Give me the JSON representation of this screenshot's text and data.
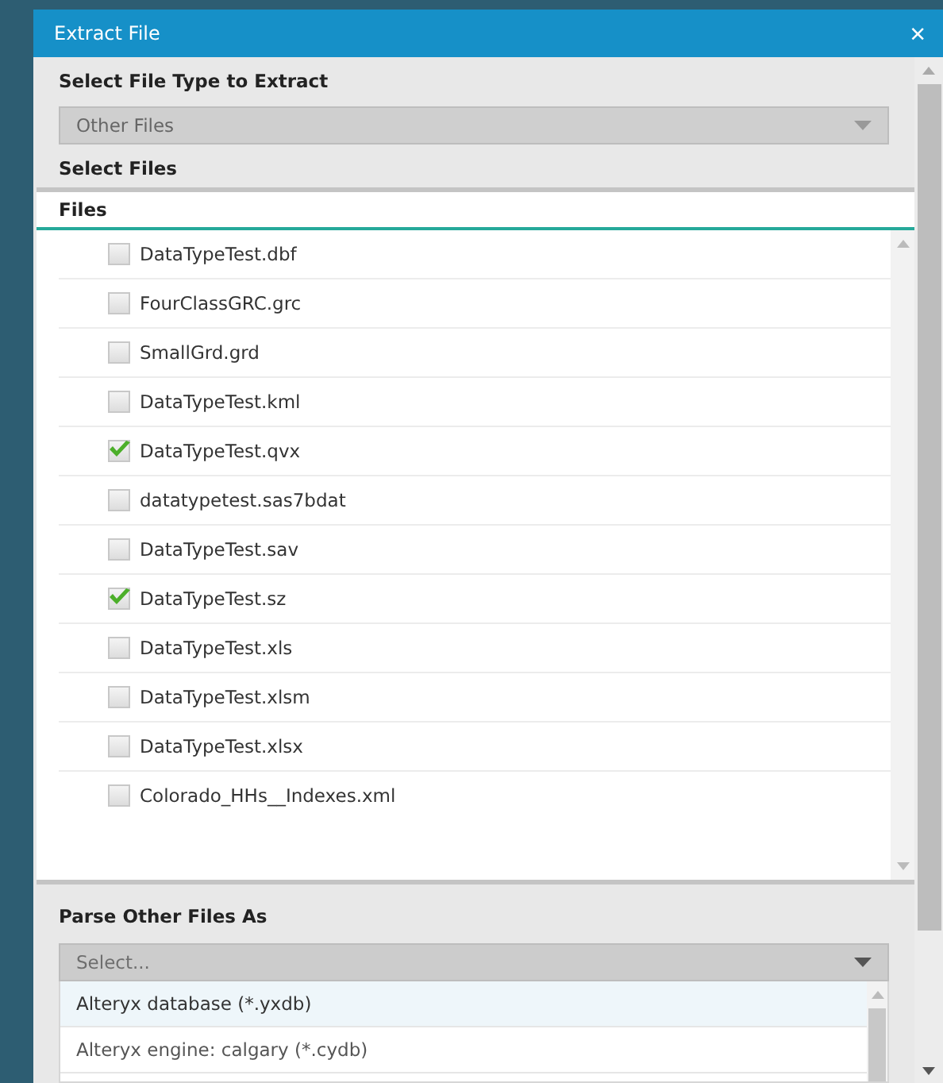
{
  "window": {
    "title": "Extract File",
    "close": "×"
  },
  "file_type": {
    "label": "Select File Type to Extract",
    "value": "Other Files"
  },
  "select_files": {
    "label": "Select Files",
    "column": "Files",
    "files": [
      {
        "name": "DataTypeTest.dbf",
        "checked": false
      },
      {
        "name": "FourClassGRC.grc",
        "checked": false
      },
      {
        "name": "SmallGrd.grd",
        "checked": false
      },
      {
        "name": "DataTypeTest.kml",
        "checked": false
      },
      {
        "name": "DataTypeTest.qvx",
        "checked": true
      },
      {
        "name": "datatypetest.sas7bdat",
        "checked": false
      },
      {
        "name": "DataTypeTest.sav",
        "checked": false
      },
      {
        "name": "DataTypeTest.sz",
        "checked": true
      },
      {
        "name": "DataTypeTest.xls",
        "checked": false
      },
      {
        "name": "DataTypeTest.xlsm",
        "checked": false
      },
      {
        "name": "DataTypeTest.xlsx",
        "checked": false
      },
      {
        "name": "Colorado_HHs__Indexes.xml",
        "checked": false
      }
    ]
  },
  "parse_as": {
    "label": "Parse Other Files As",
    "placeholder": "Select...",
    "options": [
      {
        "label": "Alteryx database (*.yxdb)",
        "highlighted": true
      },
      {
        "label": "Alteryx engine: calgary (*.cydb)",
        "highlighted": false
      }
    ]
  }
}
